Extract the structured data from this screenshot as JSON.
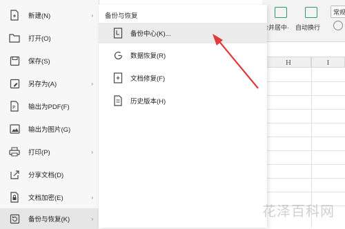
{
  "left_menu": {
    "items": [
      {
        "label": "新建(N)",
        "icon": "new-file-icon",
        "has_submenu": true
      },
      {
        "label": "打开(O)",
        "icon": "open-folder-icon",
        "has_submenu": false
      },
      {
        "label": "保存(S)",
        "icon": "save-icon",
        "has_submenu": false
      },
      {
        "label": "另存为(A)",
        "icon": "save-as-icon",
        "has_submenu": true
      },
      {
        "label": "输出为PDF(F)",
        "icon": "pdf-icon",
        "has_submenu": false
      },
      {
        "label": "输出为图片(G)",
        "icon": "image-icon",
        "has_submenu": false
      },
      {
        "label": "打印(P)",
        "icon": "print-icon",
        "has_submenu": true
      },
      {
        "label": "分享文档(D)",
        "icon": "share-icon",
        "has_submenu": false
      },
      {
        "label": "文档加密(E)",
        "icon": "lock-icon",
        "has_submenu": true
      },
      {
        "label": "备份与恢复(K)",
        "icon": "backup-icon",
        "has_submenu": true,
        "active": true
      }
    ],
    "arrow": "›"
  },
  "submenu": {
    "title": "备份与恢复",
    "items": [
      {
        "label": "备份中心(K)...",
        "icon": "backup-center-icon",
        "highlighted": true
      },
      {
        "label": "数据恢复(R)",
        "icon": "data-recovery-icon"
      },
      {
        "label": "文档修复(F)",
        "icon": "document-repair-icon"
      },
      {
        "label": "历史版本(H)",
        "icon": "history-version-icon"
      }
    ]
  },
  "background": {
    "toolbar": {
      "merge_center": "合并居中·",
      "wrap_text": "自动换行",
      "normal": "常规"
    },
    "columns": [
      "H",
      "I"
    ]
  },
  "watermark": "花泽百科网",
  "colors": {
    "accent_green": "#2d9a5e",
    "arrow_red": "#e23a3a",
    "active_bg": "#e6e6e6"
  }
}
